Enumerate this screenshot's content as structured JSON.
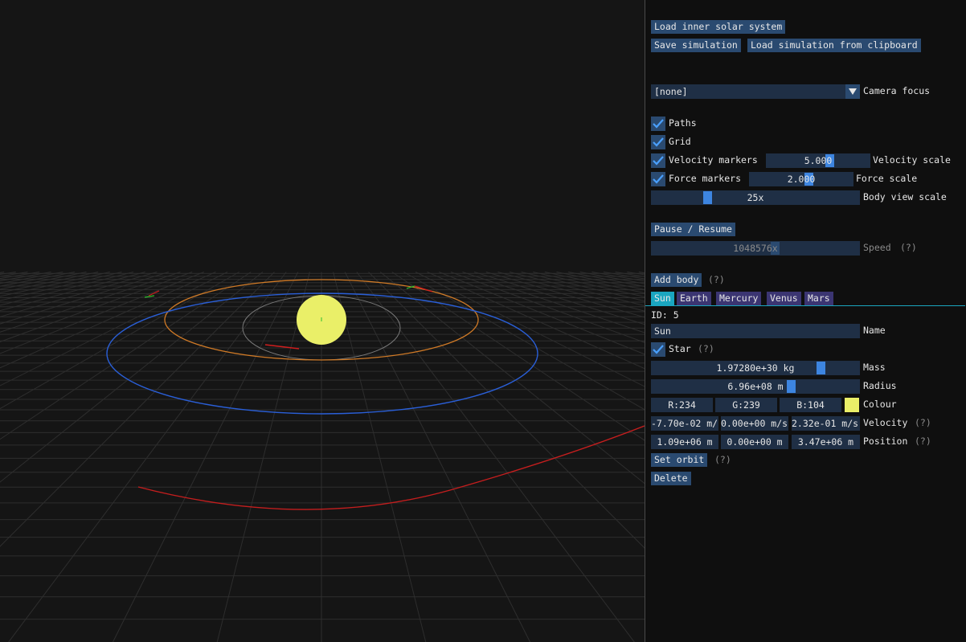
{
  "buttons": {
    "load_inner": "Load inner solar system",
    "save_sim": "Save simulation",
    "load_clipboard": "Load simulation from clipboard",
    "pause_resume": "Pause / Resume",
    "add_body": "Add body",
    "set_orbit": "Set orbit",
    "delete": "Delete"
  },
  "camera": {
    "selected": "[none]",
    "label": "Camera focus"
  },
  "toggles": {
    "paths": {
      "label": "Paths",
      "checked": true
    },
    "grid": {
      "label": "Grid",
      "checked": true
    },
    "velocity_markers": {
      "label": "Velocity markers",
      "checked": true
    },
    "force_markers": {
      "label": "Force markers",
      "checked": true
    }
  },
  "sliders": {
    "velocity_scale": {
      "value": "5.000",
      "label": "Velocity scale",
      "fraction": 0.62
    },
    "force_scale": {
      "value": "2.000",
      "label": "Force scale",
      "fraction": 0.58
    },
    "body_view_scale": {
      "value": "25x",
      "label": "Body view scale",
      "fraction": 0.26
    },
    "speed": {
      "value": "1048576x",
      "label": "Speed",
      "help": "(?)",
      "fraction": 0.6
    }
  },
  "add_body_help": "(?)",
  "tabs": [
    "Sun",
    "Earth",
    "Mercury",
    "Venus",
    "Mars"
  ],
  "body": {
    "id_label": "ID: 5",
    "name": "Sun",
    "name_label": "Name",
    "star_label": "Star",
    "star_help": "(?)",
    "star_checked": true,
    "mass": "1.97280e+30 kg",
    "mass_label": "Mass",
    "mass_fraction": 0.83,
    "radius": "6.96e+08 m",
    "radius_label": "Radius",
    "radius_fraction": 0.68,
    "colour": {
      "r": "R:234",
      "g": "G:239",
      "b": "B:104",
      "label": "Colour",
      "hex": "#eaef68"
    },
    "velocity": {
      "x": "-7.70e-02 m/",
      "y": "0.00e+00 m/s",
      "z": "2.32e-01 m/s",
      "label": "Velocity",
      "help": "(?)"
    },
    "position": {
      "x": "1.09e+06 m",
      "y": "0.00e+00 m",
      "z": "3.47e+06 m",
      "label": "Position",
      "help": "(?)"
    },
    "set_orbit_help": "(?)"
  },
  "colors": {
    "accent": "#3d85e0",
    "button": "#2a4a70",
    "field": "#1f2f45",
    "tab_active": "#1aa6c0",
    "tab": "#3b3572",
    "sun": "#eaef68",
    "orbit_mercury": "#8a8a8a",
    "orbit_venus": "#d07a26",
    "orbit_earth": "#2a5fd8",
    "orbit_mars": "#c41e1e"
  }
}
